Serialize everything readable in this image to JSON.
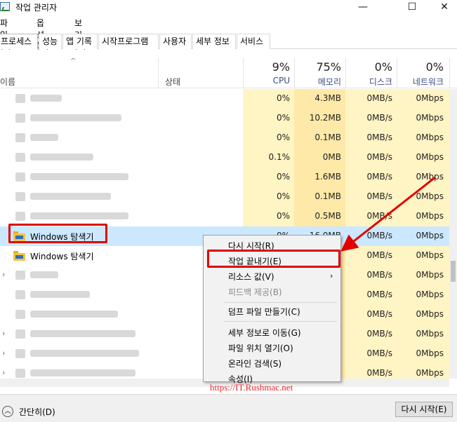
{
  "window": {
    "title": "작업 관리자"
  },
  "titlebar_buttons": {
    "minimize": "—",
    "maximize": "☐",
    "close": "✕"
  },
  "menu": [
    "파일(F)",
    "옵션(O)",
    "보기(V)"
  ],
  "tabs": [
    "프로세스",
    "성능",
    "앱 기록",
    "시작프로그램",
    "사용자",
    "세부 정보",
    "서비스"
  ],
  "columns": {
    "name": "이름",
    "status": "상태",
    "cpu": {
      "percent": "9%",
      "label": "CPU"
    },
    "memory": {
      "percent": "75%",
      "label": "메모리"
    },
    "disk": {
      "percent": "0%",
      "label": "디스크"
    },
    "network": {
      "percent": "0%",
      "label": "네트워크"
    }
  },
  "rows": [
    {
      "name": "",
      "cpu": "0%",
      "memory": "4.3MB",
      "disk": "0MB/s",
      "network": "0Mbps"
    },
    {
      "name": "",
      "cpu": "0%",
      "memory": "10.2MB",
      "disk": "0MB/s",
      "network": "0Mbps"
    },
    {
      "name": "",
      "cpu": "0%",
      "memory": "0.1MB",
      "disk": "0MB/s",
      "network": "0Mbps"
    },
    {
      "name": "",
      "cpu": "0.1%",
      "memory": "0MB",
      "disk": "0MB/s",
      "network": "0Mbps"
    },
    {
      "name": "",
      "cpu": "0%",
      "memory": "1.6MB",
      "disk": "0MB/s",
      "network": "0Mbps"
    },
    {
      "name": "",
      "cpu": "0%",
      "memory": "0.1MB",
      "disk": "0MB/s",
      "network": "0Mbps"
    },
    {
      "name": "",
      "cpu": "0%",
      "memory": "0.5MB",
      "disk": "0MB/s",
      "network": "0Mbps"
    },
    {
      "name": "Windows 탐색기",
      "cpu": "0%",
      "memory": "16.0MB",
      "disk": "0MB/s",
      "network": "0Mbps"
    },
    {
      "name": "Windows 탐색기",
      "cpu": "",
      "memory": "",
      "disk": "0MB/s",
      "network": "0Mbps"
    },
    {
      "name": "",
      "cpu": "",
      "memory": "",
      "disk": "0MB/s",
      "network": "0Mbps"
    },
    {
      "name": "",
      "cpu": "",
      "memory": "",
      "disk": "0MB/s",
      "network": "0Mbps"
    },
    {
      "name": "",
      "cpu": "",
      "memory": "",
      "disk": "0MB/s",
      "network": "0Mbps"
    },
    {
      "name": "",
      "cpu": "",
      "memory": "",
      "disk": "0MB/s",
      "network": "0Mbps"
    },
    {
      "name": "",
      "cpu": "",
      "memory": "",
      "disk": "0MB/s",
      "network": "0Mbps"
    },
    {
      "name": "",
      "cpu": "",
      "memory": "",
      "disk": "0MB/s",
      "network": "0Mbps"
    }
  ],
  "context_menu": {
    "restart": "다시 시작(R)",
    "end_task": "작업 끝내기(E)",
    "resource_values": "리소스 값(V)",
    "feedback": "피드백 제공(B)",
    "dump": "덤프 파일 만들기(C)",
    "go_to_details": "세부 정보로 이동(G)",
    "open_location": "파일 위치 열기(O)",
    "search_online": "온라인 검색(S)",
    "properties": "속성(I)"
  },
  "watermark": "https://IT.Rushmac.net",
  "footer": {
    "collapse": "간단히(D)",
    "restart_button": "다시 시작(E)"
  },
  "colors": {
    "cpu_col": "#fff4c4",
    "mem_col": "#ffe9a8",
    "selected_row": "#cce8ff",
    "highlight": "#e00000"
  }
}
